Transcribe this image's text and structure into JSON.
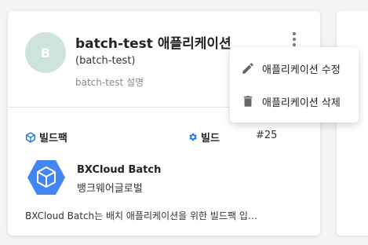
{
  "app": {
    "avatar_letter": "B",
    "title": "batch-test 애플리케이션",
    "subtitle": "(batch-test)",
    "description": "batch-test 설명"
  },
  "sections": {
    "buildpack_label": "빌드팩",
    "build_label": "빌드",
    "build_number": "#25"
  },
  "buildpack": {
    "name": "BXCloud Batch",
    "owner": "뱅크웨어글로벌",
    "description": "BXCloud Batch는 배치 애플리케이션을 위한 빌드팩 입…"
  },
  "menu": {
    "items": [
      {
        "label": "애플리케이션 수정",
        "icon": "pencil-icon"
      },
      {
        "label": "애플리케이션 삭제",
        "icon": "trash-icon"
      }
    ]
  },
  "colors": {
    "avatar_bg": "#cfe3dd",
    "accent_blue": "#1a73e8",
    "logo_blue": "#4285f4"
  }
}
